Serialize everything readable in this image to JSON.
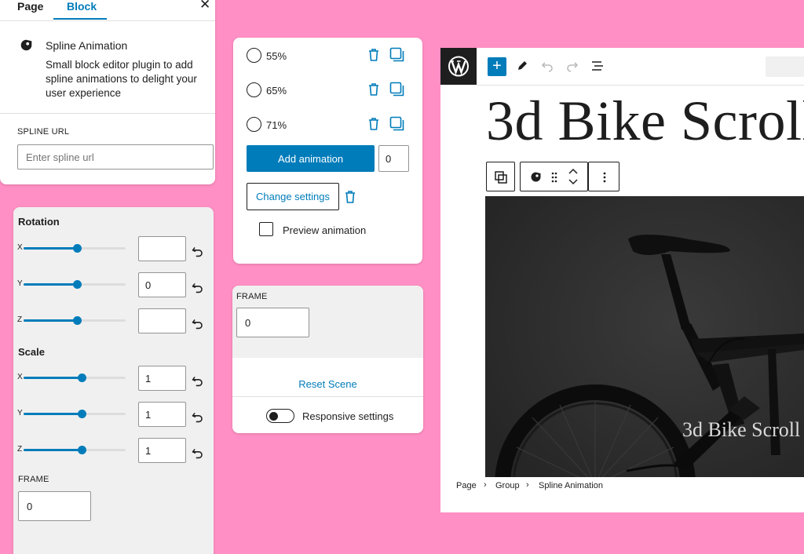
{
  "sidebar": {
    "tabs": [
      {
        "label": "Page"
      },
      {
        "label": "Block"
      }
    ],
    "close_label": "✕",
    "block": {
      "title": "Spline Animation",
      "description": "Small block editor plugin to add spline animations to delight your user experience"
    },
    "spline_url": {
      "label": "SPLINE URL",
      "placeholder": "Enter spline url",
      "value": ""
    }
  },
  "transform": {
    "rotation": {
      "heading": "Rotation",
      "axes": [
        {
          "label": "X",
          "value": "",
          "level": 0.52
        },
        {
          "label": "Y",
          "value": "0",
          "level": 0.52
        },
        {
          "label": "Z",
          "value": "",
          "level": 0.52
        }
      ]
    },
    "scale": {
      "heading": "Scale",
      "axes": [
        {
          "label": "X",
          "value": "1",
          "level": 0.57
        },
        {
          "label": "Y",
          "value": "1",
          "level": 0.57
        },
        {
          "label": "Z",
          "value": "1",
          "level": 0.57
        }
      ]
    },
    "frame": {
      "label": "FRAME",
      "value": "0"
    }
  },
  "keyframes": {
    "items": [
      {
        "label": "55%"
      },
      {
        "label": "65%"
      },
      {
        "label": "71%"
      }
    ],
    "add_button": "Add animation",
    "add_value": "0",
    "change_button": "Change settings",
    "preview_label": "Preview animation"
  },
  "scene": {
    "frame_label": "FRAME",
    "frame_value": "0",
    "reset_label": "Reset Scene",
    "responsive_label": "Responsive settings"
  },
  "editor": {
    "add_label": "+",
    "title": "3d Bike Scroll",
    "overlay_text": "3d Bike Scroll",
    "breadcrumbs": [
      "Page",
      "Group",
      "Spline Animation"
    ],
    "breadcrumb_sep": "›"
  },
  "colors": {
    "accent": "#007cba",
    "background": "#ff8fc4",
    "dark": "#1e1e1e"
  }
}
